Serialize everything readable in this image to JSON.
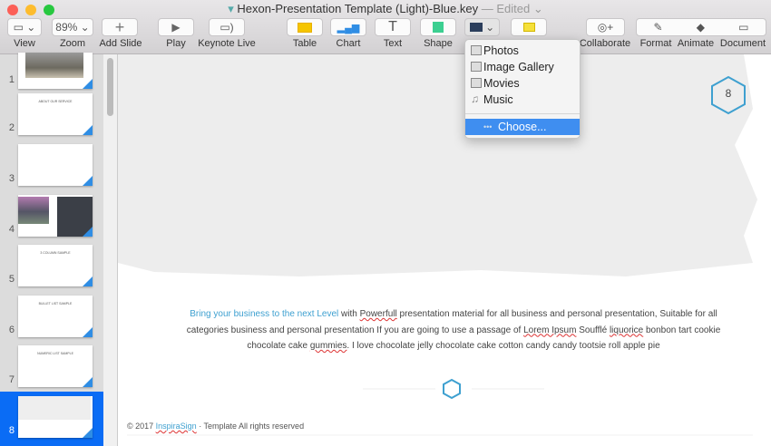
{
  "window": {
    "title": "Hexon-Presentation Template (Light)-Blue.key",
    "status": "— Edited ⌄"
  },
  "toolbar": {
    "view": "View",
    "zoom": "Zoom",
    "zoom_value": "89%",
    "add_slide": "Add Slide",
    "play": "Play",
    "keynote_live": "Keynote Live",
    "table": "Table",
    "chart": "Chart",
    "text": "Text",
    "shape": "Shape",
    "collaborate": "Collaborate",
    "format": "Format",
    "animate": "Animate",
    "document": "Document"
  },
  "media_menu": {
    "items": [
      "Photos",
      "Image Gallery",
      "Movies",
      "Music"
    ],
    "choose": "Choose..."
  },
  "slides": [
    {
      "num": "1",
      "title": ""
    },
    {
      "num": "2",
      "title": "ABOUT OUR SERVICE"
    },
    {
      "num": "3",
      "title": ""
    },
    {
      "num": "4",
      "title": ""
    },
    {
      "num": "5",
      "title": "3 COLUMN SAMPLE"
    },
    {
      "num": "6",
      "title": "BULLET LIST SAMPLE"
    },
    {
      "num": "7",
      "title": "NUMERIC LIST SAMPLE"
    },
    {
      "num": "8",
      "title": ""
    }
  ],
  "selected_slide": 8,
  "slide": {
    "page_number": "8",
    "highlight": "Bring your business to the next Level",
    "t1": " with ",
    "w1": "Powerfull",
    "t2": " presentation material for all business and personal presentation, Suitable for all categories business and personal presentation If you are going to use a passage of ",
    "w2": "Lorem Ipsum",
    "t3": " Soufflé ",
    "w3": "liquorice",
    "t4": " bonbon tart cookie chocolate cake ",
    "w4": "gummies",
    "t5": ". I love chocolate jelly chocolate cake cotton candy candy tootsie roll apple pie",
    "footer_pre": "© 2017 ",
    "footer_brand": "InspiraSign",
    "footer_post": " · Template All rights reserved"
  },
  "colors": {
    "accent": "#3ea0d0",
    "selection": "#0a6cf5",
    "menu_highlight": "#3f8ef0"
  }
}
